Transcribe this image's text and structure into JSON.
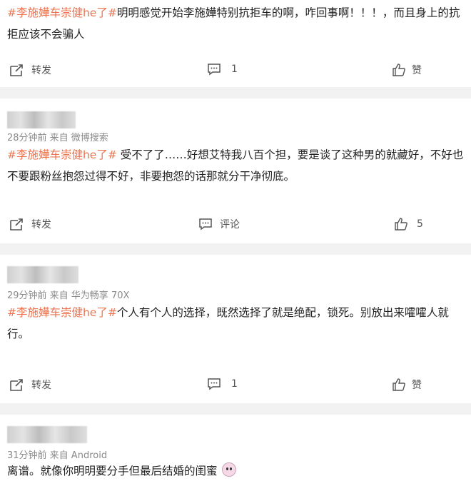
{
  "posts": [
    {
      "hashtag": "#李施嬅车崇健he了#",
      "text": "明明感觉开始李施嬅特别抗拒车的啊，咋回事啊！！！，而且身上的抗拒应该不会骗人",
      "actions": {
        "repost": "转发",
        "comment": "1",
        "like": "赞"
      }
    },
    {
      "meta": "28分钟前  来自 微博搜索",
      "hashtag": "#李施嬅车崇健he了#",
      "text": " 受不了了……好想艾特我八百个担，要是谈了这种男的就藏好，不好也不要跟粉丝抱怨过得不好，非要抱怨的话那就分干净彻底。",
      "actions": {
        "repost": "转发",
        "comment": "评论",
        "like": "5"
      }
    },
    {
      "meta": "29分钟前  来自 华为畅享 70X",
      "hashtag": "#李施嬅车崇健he了#",
      "text": "个人有个人的选择，既然选择了就是绝配，锁死。别放出来嚯嚯人就行。",
      "actions": {
        "repost": "转发",
        "comment": "1",
        "like": "赞"
      }
    },
    {
      "meta": "31分钟前  来自 Android",
      "text": "离谱。就像你明明要分手但最后结婚的闺蜜"
    }
  ]
}
